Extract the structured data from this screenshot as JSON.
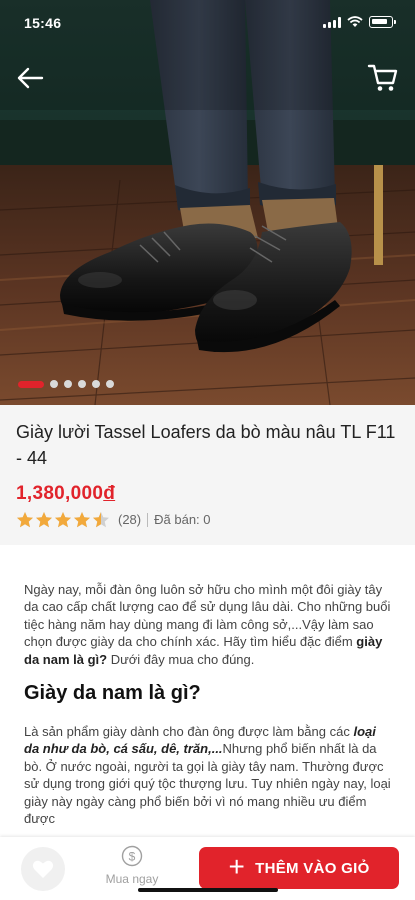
{
  "status_bar": {
    "time": "15:46"
  },
  "gallery": {
    "total_images": 6,
    "active_index": 0
  },
  "product": {
    "title": "Giày lười Tassel Loafers da bò màu nâu TL F11 - 44",
    "price_number": "1,380,000",
    "price_currency": "đ",
    "rating": 4.5,
    "rating_count": "(28)",
    "sold_label": "Đã bán: 0"
  },
  "description": {
    "intro": "Ngày nay, mỗi đàn ông luôn sở hữu cho mình một đôi giày tây da cao cấp chất lượng cao để sử dụng lâu dài. Cho những buổi tiệc hàng năm hay dùng mang đi làm công sở,...Vậy làm sao chọn được giày da cho chính xác. Hãy tìm hiểu đặc điểm ",
    "intro_bold": "giày da nam là gì?",
    "intro_end": " Dưới đây mua cho đúng.",
    "heading": "Giày da nam là gì?",
    "body_start": "Là sản phẩm giày dành cho đàn ông được làm bằng các ",
    "body_bold": "loại da như da bò, cá sấu, dê, trăn,...",
    "body_end": "Nhưng phổ biến nhất là da bò. Ở nước ngoài, người ta gọi là giày tây nam. Thường được sử dụng trong giới quý tộc thượng lưu. Tuy nhiên ngày nay, loại giày này ngày càng phổ biến bởi vì nó mang nhiều ưu điểm được"
  },
  "bottom_bar": {
    "buy_now_label": "Mua ngay",
    "add_to_cart_label": "THÊM VÀO GIỎ"
  },
  "colors": {
    "accent": "#e1232b",
    "star": "#f2a93b"
  },
  "icons": {
    "back": "arrow-left-icon",
    "cart": "cart-icon",
    "wishlist": "heart-icon",
    "buy_now": "dollar-coin-icon",
    "add": "plus-icon"
  }
}
